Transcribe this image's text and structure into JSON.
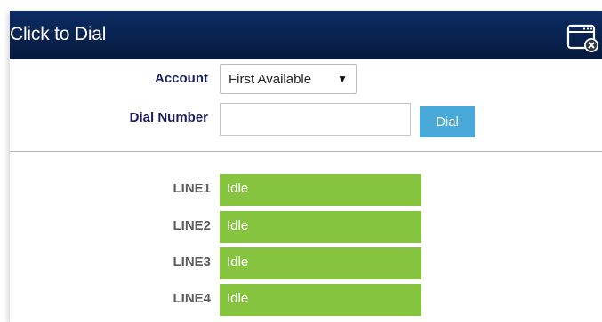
{
  "dialog": {
    "title": "Click to Dial",
    "close_icon": "window-close-icon"
  },
  "account": {
    "label": "Account",
    "selected": "First Available",
    "arrow": "▼"
  },
  "dial_number": {
    "label": "Dial Number",
    "value": "",
    "button_label": "Dial"
  },
  "lines": [
    {
      "label": "LINE1",
      "status": "Idle"
    },
    {
      "label": "LINE2",
      "status": "Idle"
    },
    {
      "label": "LINE3",
      "status": "Idle"
    },
    {
      "label": "LINE4",
      "status": "Idle"
    }
  ],
  "colors": {
    "titlebar": "#09224f",
    "label_text": "#1b1f5e",
    "dial_button": "#48a9d9",
    "line_idle": "#86c440"
  }
}
